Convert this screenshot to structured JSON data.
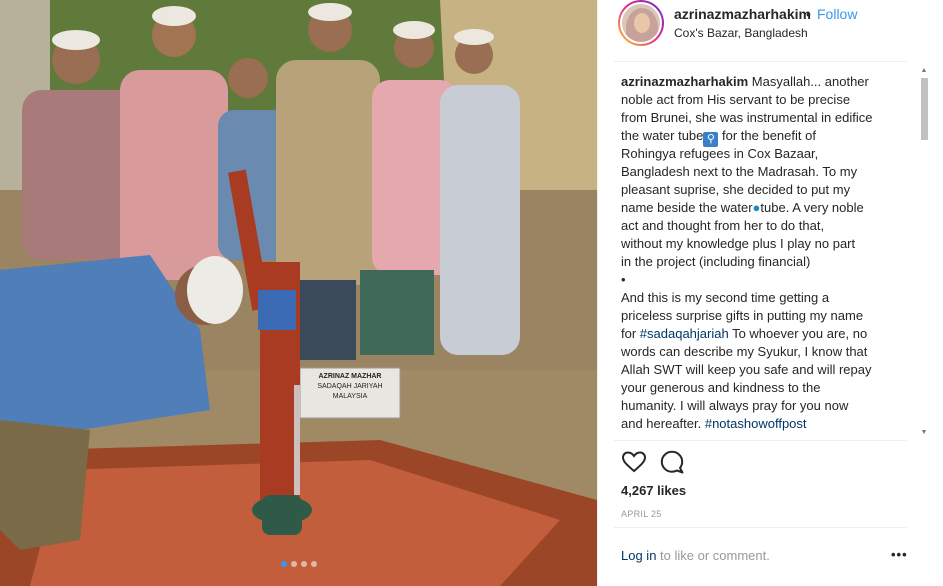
{
  "post": {
    "username": "azrinazmazharhakim",
    "separator": "•",
    "follow_label": "Follow",
    "location": "Cox's Bazar, Bangladesh"
  },
  "photo": {
    "sign_line1": "AZRINAZ MAZHAR",
    "sign_line2": "SADAQAH JARIYAH",
    "sign_line3": "MALAYSIA",
    "carousel_count": 4,
    "carousel_active": 1
  },
  "caption": {
    "username": "azrinazmazharhakim",
    "first_line": "Masyallah... another",
    "lines": [
      "noble act from His servant to be precise",
      "from Brunei, she was instrumental in edifice"
    ],
    "line4_before": "the water tube",
    "line4_emoji": "💧",
    "line4_after": " for the benefit of",
    "lines2": [
      "Rohingya refugees in Cox Bazaar,",
      "Bangladesh next to the Madrasah. To my",
      "pleasant suprise, she decided to put my"
    ],
    "line8_before": "name beside the water",
    "line8_emoji": "💧",
    "line8_after": "tube. A very noble",
    "lines3": [
      "act and thought from her to do that,",
      "without my knowledge plus I play no part",
      "in the project (including financial)",
      "•",
      "And this is my second time getting a",
      "priceless surprise gifts in putting my name"
    ],
    "line18_before": "for ",
    "line18_tag": "#sadaqahjariah",
    "line18_after": " To whoever you are, no",
    "lines4": [
      "words can describe my Syukur, I know that",
      "Allah SWT will keep you safe and will repay",
      "your generous and kindness to the",
      "humanity. I will always pray for you now"
    ],
    "line23_before": "and hereafter. ",
    "line23_tag": "#notashowoffpost"
  },
  "actions": {
    "like_icon": "heart-icon",
    "comment_icon": "comment-icon"
  },
  "likes_text": "4,267 likes",
  "date_text": "APRIL 25",
  "footer": {
    "login_link": "Log in",
    "login_rest": " to like or comment.",
    "more_label": "•••"
  },
  "colors": {
    "link_blue": "#3897f0",
    "hashtag": "#003569",
    "muted": "#999999"
  }
}
